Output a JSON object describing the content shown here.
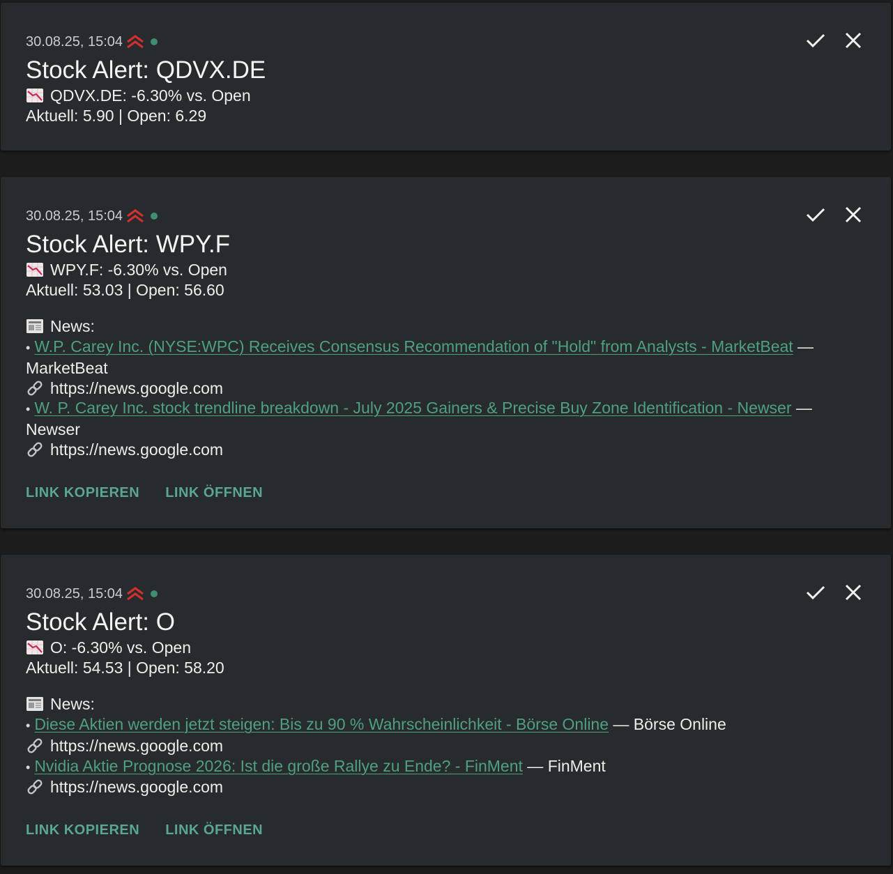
{
  "colors": {
    "background": "#1c1c1c",
    "card": "#272b2e",
    "accent": "#4e9f83",
    "priority": "#d32f2f",
    "status_dot": "#3f8f6e"
  },
  "notifications": [
    {
      "timestamp": "30.08.25, 15:04",
      "priority_icon": "double-chevron-up-icon",
      "status": "online",
      "title": "Stock Alert: QDVX.DE",
      "change_line": "QDVX.DE: -6.30% vs. Open",
      "price_line": "Aktuell: 5.90 | Open: 6.29",
      "news_heading": "",
      "news": [],
      "buttons": []
    },
    {
      "timestamp": "30.08.25, 15:04",
      "priority_icon": "double-chevron-up-icon",
      "status": "online",
      "title": "Stock Alert: WPY.F",
      "change_line": "WPY.F: -6.30% vs. Open",
      "price_line": "Aktuell: 53.03 | Open: 56.60",
      "news_heading": "News:",
      "news": [
        {
          "title": "W.P. Carey Inc. (NYSE:WPC) Receives Consensus Recommendation of \"Hold\" from Analysts - MarketBeat",
          "source_sep": " —",
          "source": "MarketBeat",
          "url": "https://news.google.com"
        },
        {
          "title": "W. P. Carey Inc. stock trendline breakdown - July 2025 Gainers & Precise Buy Zone Identification - Newser",
          "source_sep": " —",
          "source": "Newser",
          "url": "https://news.google.com"
        }
      ],
      "buttons": [
        "LINK KOPIEREN",
        "LINK ÖFFNEN"
      ]
    },
    {
      "timestamp": "30.08.25, 15:04",
      "priority_icon": "double-chevron-up-icon",
      "status": "online",
      "title": "Stock Alert: O",
      "change_line": "O: -6.30% vs. Open",
      "price_line": "Aktuell: 54.53 | Open: 58.20",
      "news_heading": "News:",
      "news": [
        {
          "title": "Diese Aktien werden jetzt steigen: Bis zu 90 % Wahrscheinlichkeit - Börse Online",
          "source_sep": " — ",
          "source": "Börse Online",
          "url": "https://news.google.com"
        },
        {
          "title": "Nvidia Aktie Prognose 2026: Ist die große Rallye zu Ende? - FinMent",
          "source_sep": " — ",
          "source": "FinMent",
          "url": "https://news.google.com"
        }
      ],
      "buttons": [
        "LINK KOPIEREN",
        "LINK ÖFFNEN"
      ]
    }
  ]
}
